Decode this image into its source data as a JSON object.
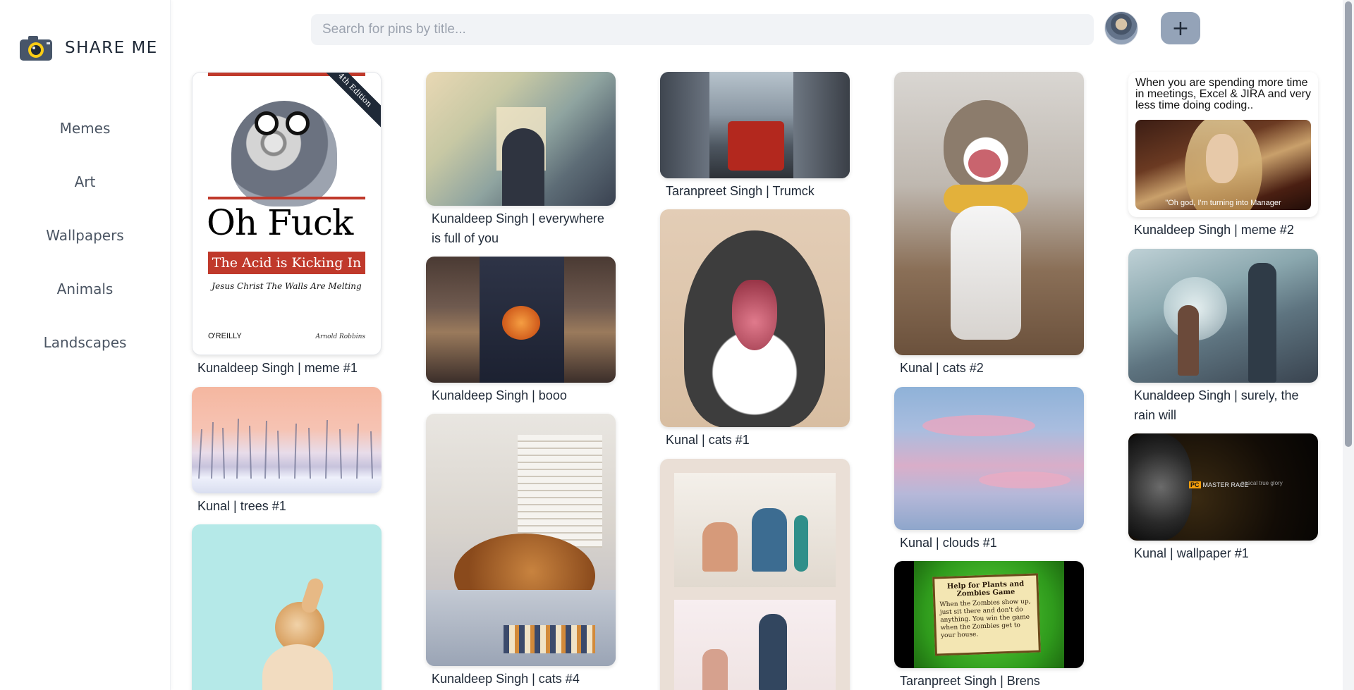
{
  "app": {
    "brand": "SHARE ME"
  },
  "sidebar": {
    "items": [
      {
        "label": "Memes"
      },
      {
        "label": "Art"
      },
      {
        "label": "Wallpapers"
      },
      {
        "label": "Animals"
      },
      {
        "label": "Landscapes"
      }
    ]
  },
  "search": {
    "placeholder": "Search for pins by title..."
  },
  "header": {
    "add_label": "+"
  },
  "pins": {
    "col1": [
      {
        "caption": "Kunaldeep Singh | meme #1",
        "book": {
          "edition": "4th Edition",
          "title": "Oh Fuck",
          "band": "The Acid is Kicking In",
          "subtitle": "Jesus Christ The Walls Are Melting",
          "publisher": "O'REILLY",
          "author": "Arnold Robbins"
        }
      },
      {
        "caption": "Kunal | trees #1"
      },
      {
        "caption": ""
      }
    ],
    "col2": [
      {
        "caption": "Kunaldeep Singh | everywhere is full of you"
      },
      {
        "caption": "Kunaldeep Singh | booo"
      },
      {
        "caption": "Kunaldeep Singh | cats #4"
      }
    ],
    "col3": [
      {
        "caption": "Taranpreet Singh | Trumck"
      },
      {
        "caption": "Kunal | cats #1"
      },
      {
        "caption": ""
      }
    ],
    "col4": [
      {
        "caption": "Kunal | cats #2"
      },
      {
        "caption": "Kunal | clouds #1"
      },
      {
        "caption": "Taranpreet Singh | Brens",
        "note": {
          "title": "Help for Plants and Zombies Game",
          "body": "When the Zombies show up, just sit there and don't do anything. You win the game when the Zombies get to your house."
        }
      }
    ],
    "col5": [
      {
        "caption": "Kunaldeep Singh | meme #2",
        "meme": {
          "text": "When you are spending more time in meetings, Excel & JIRA and very less time doing coding..",
          "subtitle": "\"Oh god, I'm turning into Manager"
        }
      },
      {
        "caption": "Kunaldeep Singh | surely, the rain will"
      },
      {
        "caption": "Kunal | wallpaper #1",
        "wallpaper": {
          "brand": "PC",
          "label": "MASTER RACE",
          "sub": "pascal true glory"
        }
      }
    ]
  },
  "colors": {
    "accent": "#94a3b8",
    "search_bg": "#f1f3f6",
    "book_red": "#c0392b"
  }
}
